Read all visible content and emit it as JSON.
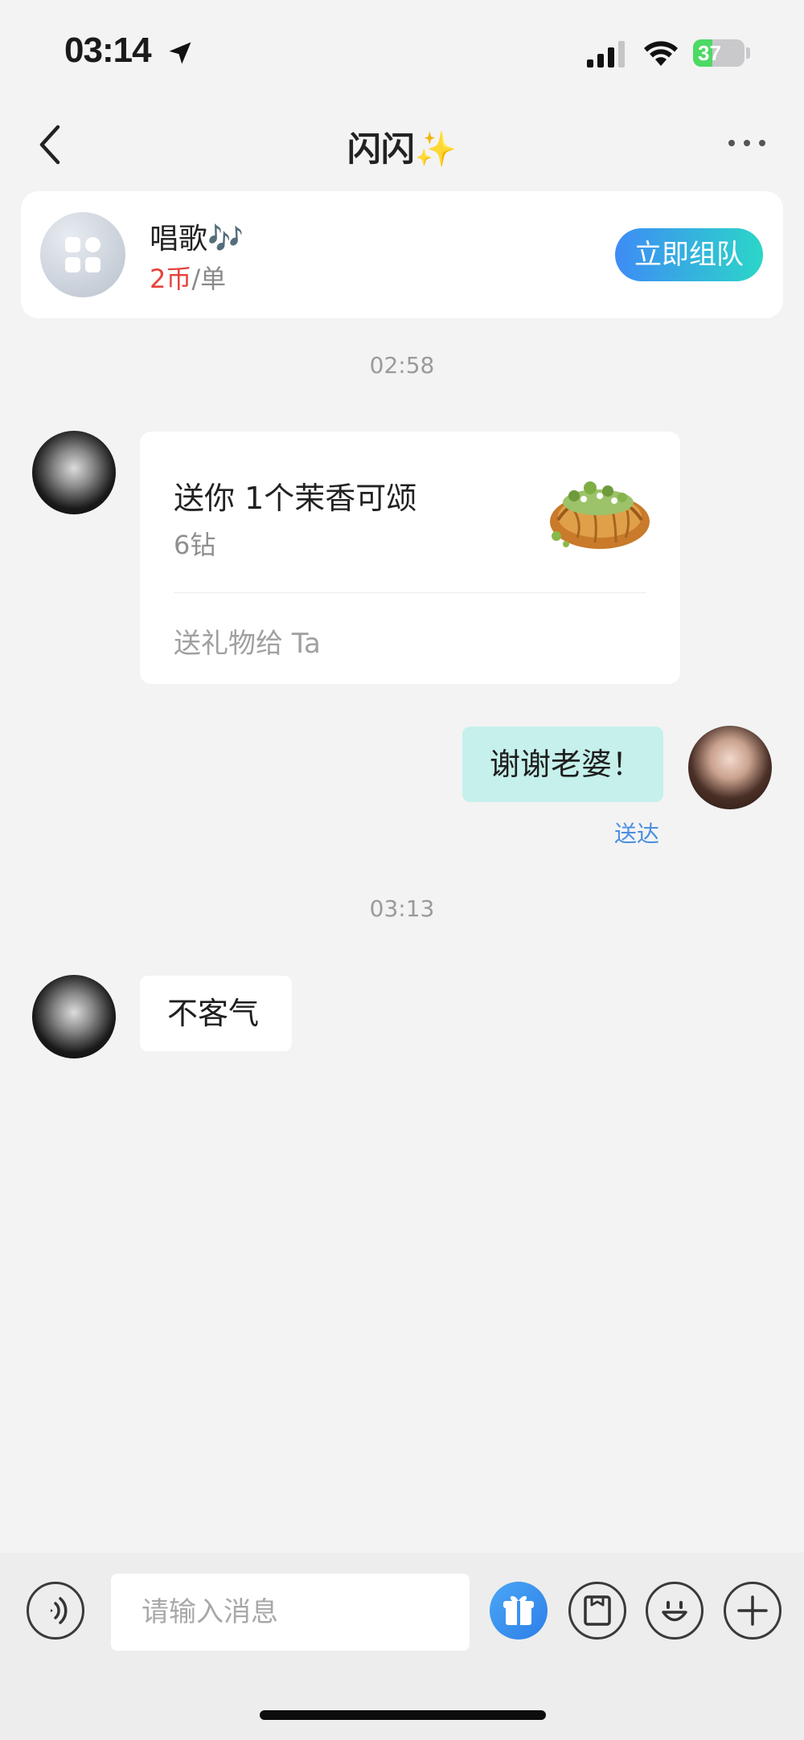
{
  "status_bar": {
    "time": "03:14",
    "battery": "37",
    "battery_level": 0.37
  },
  "nav": {
    "title": "闪闪✨",
    "back_icon": "chevron-left-icon",
    "more_icon": "ellipsis-icon"
  },
  "service": {
    "name": "唱歌🎶",
    "price_amount": "2币",
    "price_unit": "/单",
    "action": "立即组队",
    "icon": "grid-apps-icon"
  },
  "messages": {
    "time_1": "02:58",
    "gift": {
      "title": "送你 1个茉香可颂",
      "price": "6钻",
      "action": "送礼物给 Ta",
      "image": "croissant-image"
    },
    "reply_me": "谢谢老婆！",
    "delivered": "送达",
    "time_2": "03:13",
    "reply_other": "不客气"
  },
  "input_bar": {
    "placeholder": "请输入消息",
    "voice_icon": "voice-icon",
    "gift_icon": "gift-icon",
    "album_icon": "photo-album-icon",
    "emoji_icon": "emoji-icon",
    "plus_icon": "plus-icon"
  },
  "colors": {
    "accent_gradient_start": "#3e8cf5",
    "accent_gradient_end": "#2bd6c8",
    "price_red": "#e5433d",
    "my_bubble": "#c6f0eb",
    "delivered_blue": "#4a8fe0"
  }
}
